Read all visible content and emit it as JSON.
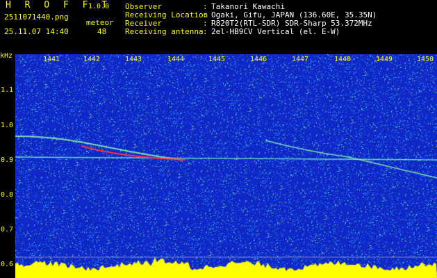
{
  "app": {
    "name": "H R O F F T",
    "version": "1.0.0"
  },
  "file": {
    "name": "2511071440.png",
    "datetime": "25.11.07 14:40"
  },
  "counter": {
    "label": "meteor",
    "value": "48"
  },
  "station": [
    {
      "label": "Observer",
      "value": "Takanori Kawachi"
    },
    {
      "label": "Receiving Location",
      "value": "Ogaki, Gifu, JAPAN (136.60E, 35.35N)"
    },
    {
      "label": "Receiver",
      "value": "R820T2(RTL-SDR) SDR-Sharp 53.372MHz"
    },
    {
      "label": "Receiving antenna",
      "value": "2el-HB9CV Vertical (el. E-W)"
    }
  ],
  "separator": ":",
  "y_unit": "kHz",
  "time_ticks": [
    "1441",
    "1442",
    "1443",
    "1444",
    "1445",
    "1446",
    "1447",
    "1448",
    "1449",
    "1450"
  ],
  "freq_ticks": [
    "1.1",
    "1.0",
    "0.9",
    "0.8",
    "0.7",
    "0.6"
  ],
  "colors": {
    "label": "#ffff00",
    "background": "#1030c0",
    "signal": "#ff3040",
    "baseline": "#ffff00"
  }
}
